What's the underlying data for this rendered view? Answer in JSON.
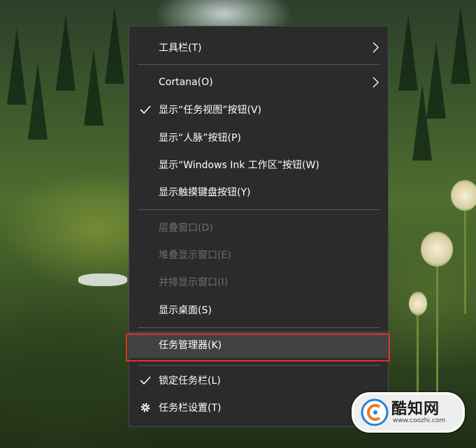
{
  "menu": {
    "items": [
      {
        "label": "工具栏(T)",
        "has_submenu": true,
        "checked": false,
        "disabled": false
      },
      {
        "label": "Cortana(O)",
        "has_submenu": true,
        "checked": false,
        "disabled": false
      },
      {
        "label": "显示“任务视图”按钮(V)",
        "has_submenu": false,
        "checked": true,
        "disabled": false
      },
      {
        "label": "显示“人脉”按钮(P)",
        "has_submenu": false,
        "checked": false,
        "disabled": false
      },
      {
        "label": "显示“Windows Ink 工作区”按钮(W)",
        "has_submenu": false,
        "checked": false,
        "disabled": false
      },
      {
        "label": "显示触摸键盘按钮(Y)",
        "has_submenu": false,
        "checked": false,
        "disabled": false
      },
      {
        "label": "层叠窗口(D)",
        "has_submenu": false,
        "checked": false,
        "disabled": true
      },
      {
        "label": "堆叠显示窗口(E)",
        "has_submenu": false,
        "checked": false,
        "disabled": true
      },
      {
        "label": "并排显示窗口(I)",
        "has_submenu": false,
        "checked": false,
        "disabled": true
      },
      {
        "label": "显示桌面(S)",
        "has_submenu": false,
        "checked": false,
        "disabled": false
      },
      {
        "label": "任务管理器(K)",
        "has_submenu": false,
        "checked": false,
        "disabled": false,
        "highlighted": true
      },
      {
        "label": "锁定任务栏(L)",
        "has_submenu": false,
        "checked": true,
        "disabled": false
      },
      {
        "label": "任务栏设置(T)",
        "has_submenu": false,
        "checked": false,
        "disabled": false,
        "icon": "gear-icon"
      }
    ]
  },
  "highlight_color": "#d9342b",
  "watermark": {
    "title": "酷知网",
    "subtitle": "www.coozhi.com"
  }
}
